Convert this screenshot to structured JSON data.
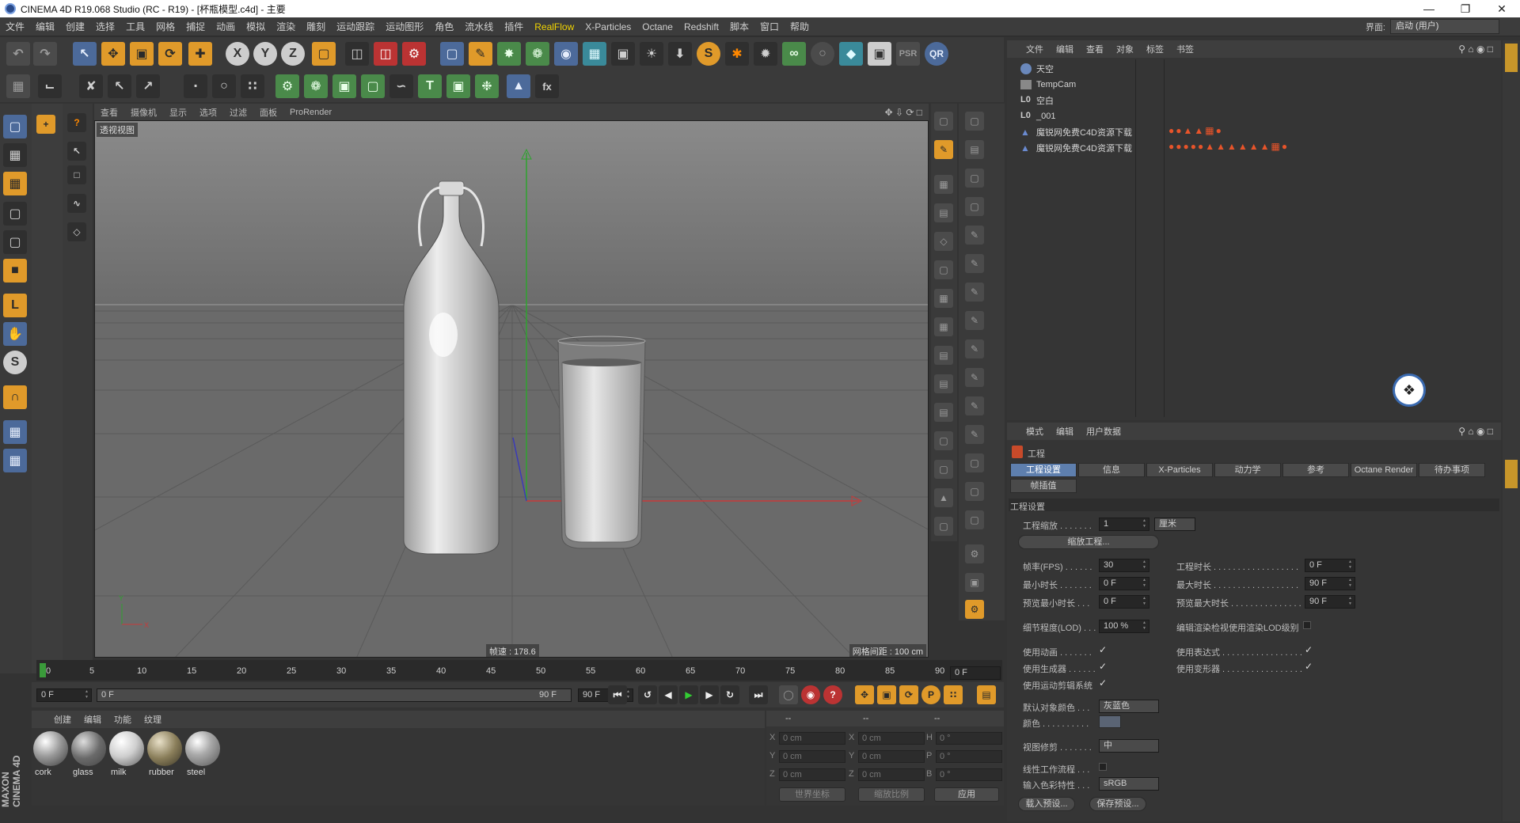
{
  "title_bar": {
    "title": "CINEMA 4D R19.068 Studio (RC - R19) - [杯瓶模型.c4d] - 主要"
  },
  "menu": {
    "items": [
      "文件",
      "编辑",
      "创建",
      "选择",
      "工具",
      "网格",
      "捕捉",
      "动画",
      "模拟",
      "渲染",
      "雕刻",
      "运动跟踪",
      "运动图形",
      "角色",
      "流水线",
      "插件",
      "RealFlow",
      "X-Particles",
      "Octane",
      "Redshift",
      "脚本",
      "窗口",
      "帮助"
    ],
    "highlight": "RealFlow",
    "layout_label": "界面:",
    "layout_value": "启动 (用户)"
  },
  "viewport": {
    "menu": [
      "查看",
      "摄像机",
      "显示",
      "选项",
      "过滤",
      "面板",
      "ProRender"
    ],
    "name": "透视视图",
    "speed": "帧速 : 178.6",
    "grid": "网格间距 : 100 cm"
  },
  "objects": {
    "menu": [
      "文件",
      "编辑",
      "查看",
      "对象",
      "标签",
      "书签"
    ],
    "rows": [
      {
        "name": "天空",
        "icon": "sky-icon"
      },
      {
        "name": "TempCam",
        "icon": "camera-icon"
      },
      {
        "name": "空白",
        "icon": "null-icon"
      },
      {
        "name": "_001",
        "icon": "null-icon"
      },
      {
        "name": "魔锐网免费C4D资源下载",
        "icon": "object-icon"
      },
      {
        "name": "魔锐网免费C4D资源下载",
        "icon": "object-icon"
      }
    ]
  },
  "attributes": {
    "menu": [
      "模式",
      "编辑",
      "用户数据"
    ],
    "section": "工程",
    "tabs": [
      "工程设置",
      "信息",
      "X-Particles",
      "动力学",
      "参考",
      "Octane Render",
      "待办事项",
      "帧插值"
    ],
    "group": "工程设置",
    "scale_label": "工程缩放 . . . . . . .",
    "scale_value": "1",
    "scale_unit": "厘米",
    "scale_btn": "缩放工程...",
    "fps_label": "帧率(FPS) . . . . . .",
    "fps_value": "30",
    "time_label": "工程时长 . . . . . . . . . . . . . . . . . .",
    "time_value": "0 F",
    "min_label": "最小时长 . . . . . . .",
    "min_value": "0 F",
    "max_label": "最大时长 . . . . . . . . . . . . . . . . . .",
    "max_value": "90 F",
    "pmin_label": "预览最小时长 . . .",
    "pmin_value": "0 F",
    "pmax_label": "预览最大时长 . . . . . . . . . . . . . . .",
    "pmax_value": "90 F",
    "lod_label": "细节程度(LOD) . . .",
    "lod_value": "100 %",
    "lod_render_label": "编辑渲染检视使用渲染LOD级别",
    "anim_label": "使用动画 . . . . . . .",
    "expr_label": "使用表达式 . . . . . . . . . . . . . . . . .",
    "gen_label": "使用生成器 . . . . . .",
    "deform_label": "使用变形器 . . . . . . . . . . . . . . . . .",
    "motion_label": "使用运动剪辑系统",
    "defcolor_label": "默认对象颜色 . . .",
    "defcolor_value": "灰蓝色",
    "color_label": "颜色 . . . . . . . . . .",
    "clip_label": "视图修剪 . . . . . . .",
    "clip_value": "中",
    "linear_label": "线性工作流程 . . .",
    "profile_label": "输入色彩特性 . . .",
    "profile_value": "sRGB",
    "load_btn": "载入预设...",
    "save_btn": "保存预设..."
  },
  "timeline": {
    "ticks": [
      "0",
      "5",
      "10",
      "15",
      "20",
      "25",
      "30",
      "35",
      "40",
      "45",
      "50",
      "55",
      "60",
      "65",
      "70",
      "75",
      "80",
      "85",
      "90"
    ],
    "current": "0 F",
    "start": "0 F",
    "range_start": "0 F",
    "range_end": "90 F",
    "end": "90 F"
  },
  "materials": {
    "menu": [
      "创建",
      "编辑",
      "功能",
      "纹理"
    ],
    "items": [
      "cork",
      "glass",
      "milk",
      "rubber",
      "steel"
    ]
  },
  "coordinates": {
    "header": [
      "--",
      "--",
      "--"
    ],
    "rows": [
      {
        "a": "X",
        "av": "0 cm",
        "b": "X",
        "bv": "0 cm",
        "c": "H",
        "cv": "0 °"
      },
      {
        "a": "Y",
        "av": "0 cm",
        "b": "Y",
        "bv": "0 cm",
        "c": "P",
        "cv": "0 °"
      },
      {
        "a": "Z",
        "av": "0 cm",
        "b": "Z",
        "bv": "0 cm",
        "c": "B",
        "cv": "0 °"
      }
    ],
    "world": "世界坐标",
    "scale": "缩放比例",
    "apply": "应用"
  },
  "brand": "MAXON CINEMA 4D",
  "colors": {
    "accent": "#5e7fae",
    "highlight": "#f2d400",
    "panel": "#353535"
  }
}
